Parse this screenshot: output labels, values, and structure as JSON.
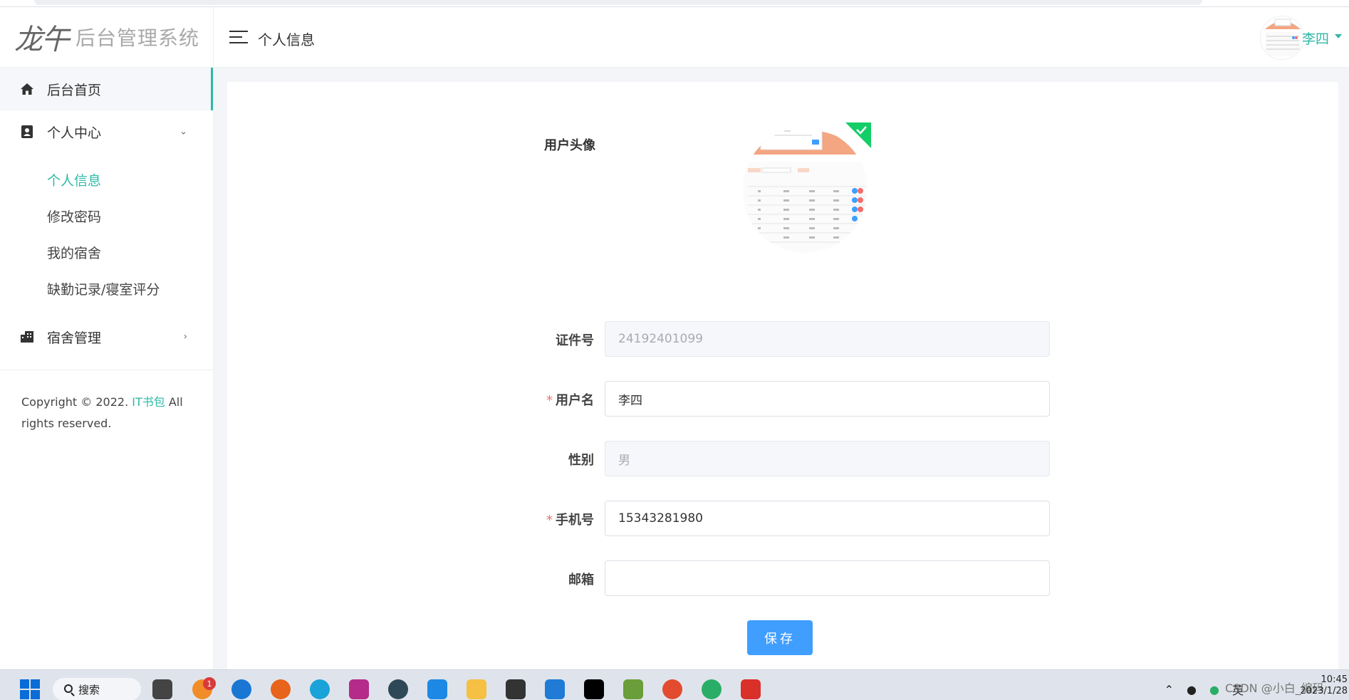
{
  "app": {
    "logo_mark": "龙午",
    "logo_text": "后台管理系统"
  },
  "sidebar": {
    "home_label": "后台首页",
    "personal_center": {
      "label": "个人中心",
      "items": [
        {
          "label": "个人信息"
        },
        {
          "label": "修改密码"
        },
        {
          "label": "我的宿舍"
        },
        {
          "label": "缺勤记录/寝室评分"
        }
      ]
    },
    "dorm_management_label": "宿舍管理",
    "copyright_prefix": "Copyright © 2022. ",
    "copyright_brand": "IT书包",
    "copyright_suffix": " All rights reserved."
  },
  "header": {
    "page_title": "个人信息",
    "user_name": "李四"
  },
  "form": {
    "avatar_label": "用户头像",
    "id_label": "证件号",
    "id_value": "24192401099",
    "username_label": "用户名",
    "username_value": "李四",
    "gender_label": "性别",
    "gender_value": "男",
    "phone_label": "手机号",
    "phone_value": "15343281980",
    "email_label": "邮箱",
    "email_value": "",
    "required_mark": "*",
    "save_label": "保存"
  },
  "taskbar": {
    "search_label": "搜索",
    "notification_count": "1",
    "ime_label": "英",
    "watermark": "CSDN @小白_编码",
    "time": "10:45",
    "date": "2023/1/28"
  },
  "colors": {
    "accent": "#2fb9a6",
    "primary_button": "#409eff",
    "required": "#f56c6c"
  }
}
